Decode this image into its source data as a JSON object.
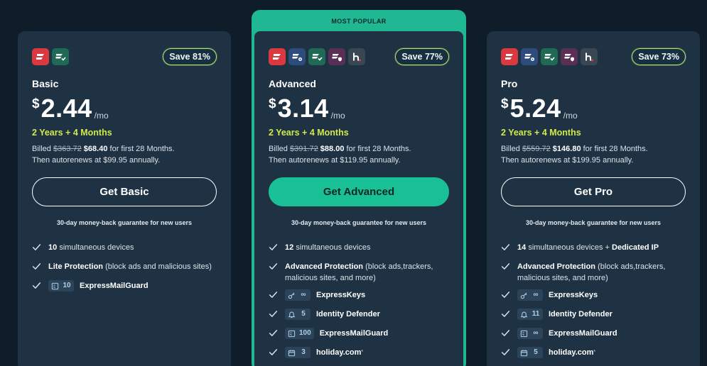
{
  "popular_label": "MOST POPULAR",
  "colors": {
    "background": "#0e1d29",
    "card": "#1f3244",
    "accent": "#19c095",
    "term": "#d2e94a",
    "badge_border": "#b8e06b"
  },
  "plans": {
    "basic": {
      "name": "Basic",
      "save": "Save 81%",
      "currency": "$",
      "price": "2.44",
      "per": "/mo",
      "term": "2 Years + 4 Months",
      "billed_prefix": "Billed",
      "old_price": "$363.72",
      "new_price": "$68.40",
      "billed_suffix": "for first 28 Months.",
      "renew": "Then autorenews at $99.95 annually.",
      "cta": "Get Basic",
      "guarantee": "30-day money-back guarantee for new users",
      "apps": [
        "expressvpn-icon",
        "expressmailguard-icon"
      ],
      "features": {
        "devices_num": "10",
        "devices_text": "simultaneous devices",
        "protection_bold": "Lite Protection",
        "protection_text": "(block ads and malicious sites)",
        "mailguard_num": "10",
        "mailguard_name": "ExpressMailGuard"
      }
    },
    "advanced": {
      "name": "Advanced",
      "save": "Save 77%",
      "currency": "$",
      "price": "3.14",
      "per": "/mo",
      "term": "2 Years + 4 Months",
      "billed_prefix": "Billed",
      "old_price": "$391.72",
      "new_price": "$88.00",
      "billed_suffix": "for first 28 Months.",
      "renew": "Then autorenews at $119.95 annually.",
      "cta": "Get Advanced",
      "guarantee": "30-day money-back guarantee for new users",
      "apps": [
        "expressvpn-icon",
        "expresskeys-icon",
        "expressmailguard-icon",
        "identity-defender-icon",
        "holiday-icon"
      ],
      "features": {
        "devices_num": "12",
        "devices_text": "simultaneous devices",
        "protection_bold": "Advanced Protection",
        "protection_text": "(block ads,trackers, malicious sites, and more)",
        "keys_num": "∞",
        "keys_name": "ExpressKeys",
        "identity_num": "5",
        "identity_name": "Identity Defender",
        "mailguard_num": "100",
        "mailguard_name": "ExpressMailGuard",
        "holiday_num": "3",
        "holiday_name": "holiday.com",
        "holiday_mark": "*"
      }
    },
    "pro": {
      "name": "Pro",
      "save": "Save 73%",
      "currency": "$",
      "price": "5.24",
      "per": "/mo",
      "term": "2 Years + 4 Months",
      "billed_prefix": "Billed",
      "old_price": "$559.72",
      "new_price": "$146.80",
      "billed_suffix": "for first 28 Months.",
      "renew": "Then autorenews at $199.95 annually.",
      "cta": "Get Pro",
      "guarantee": "30-day money-back guarantee for new users",
      "apps": [
        "expressvpn-icon",
        "expresskeys-icon",
        "expressmailguard-icon",
        "identity-defender-icon",
        "holiday-icon"
      ],
      "features": {
        "devices_num": "14",
        "devices_text": "simultaneous devices +",
        "devices_extra": "Dedicated IP",
        "protection_bold": "Advanced Protection",
        "protection_text": "(block ads,trackers, malicious sites, and more)",
        "keys_num": "∞",
        "keys_name": "ExpressKeys",
        "identity_num": "11",
        "identity_name": "Identity Defender",
        "mailguard_num": "∞",
        "mailguard_name": "ExpressMailGuard",
        "holiday_num": "5",
        "holiday_name": "holiday.com",
        "holiday_mark": "*"
      }
    }
  }
}
